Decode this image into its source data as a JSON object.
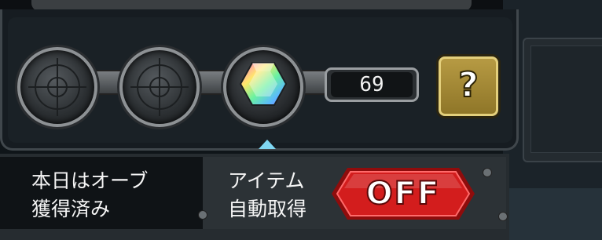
{
  "counter": {
    "value": "69"
  },
  "help_button": {
    "label": "?"
  },
  "status": {
    "line1": "本日はオーブ",
    "line2": "獲得済み"
  },
  "auto_collect": {
    "line1": "アイテム",
    "line2": "自動取得",
    "toggle_label": "OFF"
  },
  "slots": [
    {
      "name": "empty-orb-slot-1",
      "state": "empty"
    },
    {
      "name": "empty-orb-slot-2",
      "state": "empty"
    },
    {
      "name": "gem-orb-slot",
      "state": "filled",
      "icon": "rainbow-gem-icon"
    }
  ],
  "colors": {
    "toggle_red": "#d31d1d",
    "help_gold": "#b69a43",
    "indicator": "#7fd6f2"
  }
}
